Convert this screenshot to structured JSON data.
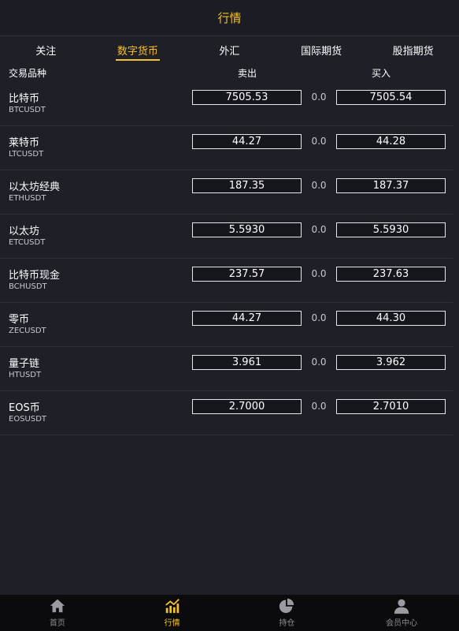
{
  "header": {
    "title": "行情"
  },
  "tabs": [
    {
      "label": "关注"
    },
    {
      "label": "数字货币"
    },
    {
      "label": "外汇"
    },
    {
      "label": "国际期货"
    },
    {
      "label": "股指期货"
    }
  ],
  "active_tab": "数字货币",
  "columns": {
    "name": "交易品种",
    "sell": "卖出",
    "buy": "买入"
  },
  "rows": [
    {
      "name": "比特币",
      "code": "BTCUSDT",
      "sell": "7505.53",
      "diff": "0.0",
      "buy": "7505.54"
    },
    {
      "name": "莱特币",
      "code": "LTCUSDT",
      "sell": "44.27",
      "diff": "0.0",
      "buy": "44.28"
    },
    {
      "name": "以太坊经典",
      "code": "ETHUSDT",
      "sell": "187.35",
      "diff": "0.0",
      "buy": "187.37"
    },
    {
      "name": "以太坊",
      "code": "ETCUSDT",
      "sell": "5.5930",
      "diff": "0.0",
      "buy": "5.5930"
    },
    {
      "name": "比特币现金",
      "code": "BCHUSDT",
      "sell": "237.57",
      "diff": "0.0",
      "buy": "237.63"
    },
    {
      "name": "零币",
      "code": "ZECUSDT",
      "sell": "44.27",
      "diff": "0.0",
      "buy": "44.30"
    },
    {
      "name": "量子链",
      "code": "HTUSDT",
      "sell": "3.961",
      "diff": "0.0",
      "buy": "3.962"
    },
    {
      "name": "EOS币",
      "code": "EOSUSDT",
      "sell": "2.7000",
      "diff": "0.0",
      "buy": "2.7010"
    }
  ],
  "nav": [
    {
      "label": "首页",
      "icon": "home-icon"
    },
    {
      "label": "行情",
      "icon": "chart-icon"
    },
    {
      "label": "持仓",
      "icon": "pie-icon"
    },
    {
      "label": "会员中心",
      "icon": "user-icon"
    }
  ],
  "active_nav": "行情",
  "colors": {
    "accent": "#f5c12c",
    "background": "#1f1f28",
    "nav_background": "#0b0b0e"
  }
}
